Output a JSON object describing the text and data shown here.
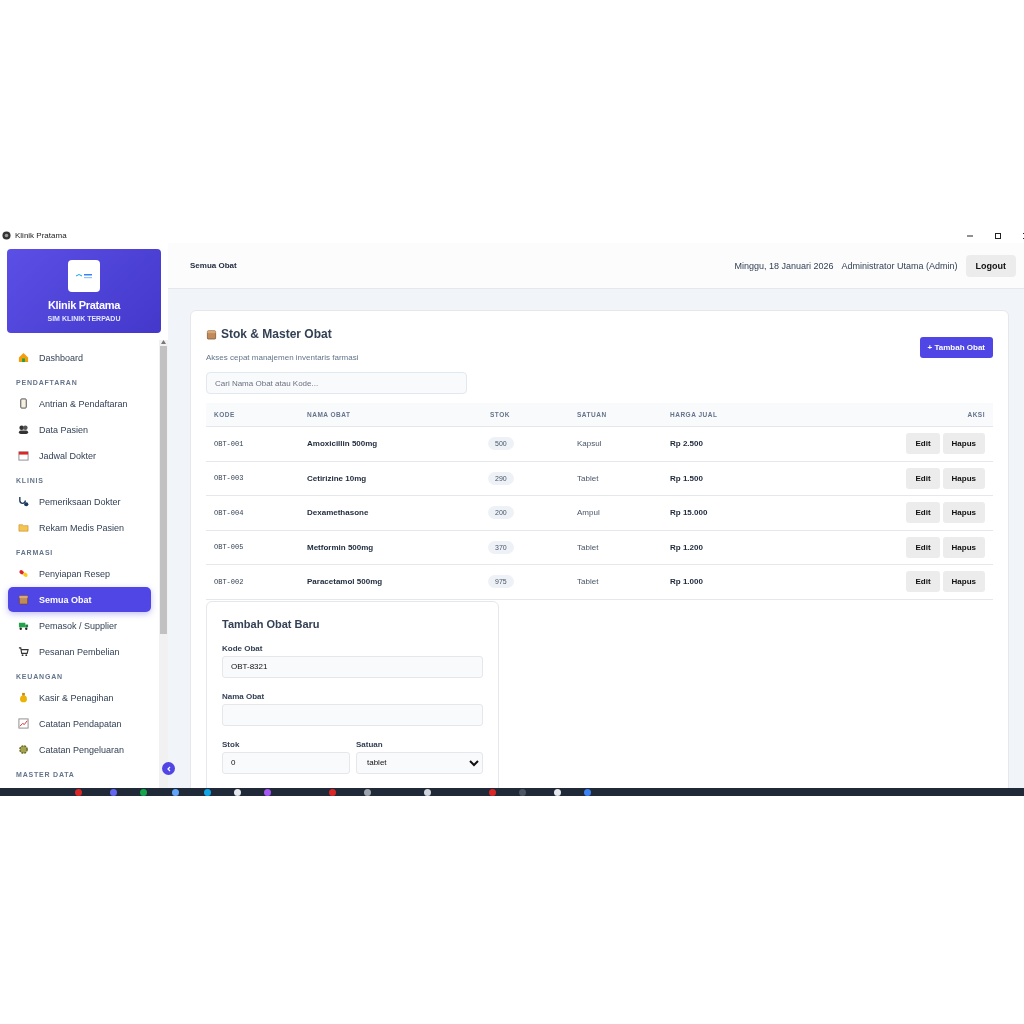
{
  "window": {
    "title": "Klinik Pratama"
  },
  "sidebar": {
    "brand": {
      "name": "Klinik Pratama",
      "tagline": "SIM KLINIK TERPADU"
    },
    "sections": [
      {
        "items": [
          {
            "label": "Dashboard",
            "selected": false
          }
        ]
      },
      {
        "heading": "PENDAFTARAN",
        "items": [
          {
            "label": "Antrian & Pendaftaran",
            "selected": false
          },
          {
            "label": "Data Pasien",
            "selected": false
          },
          {
            "label": "Jadwal Dokter",
            "selected": false
          }
        ]
      },
      {
        "heading": "KLINIS",
        "items": [
          {
            "label": "Pemeriksaan Dokter",
            "selected": false
          },
          {
            "label": "Rekam Medis Pasien",
            "selected": false
          }
        ]
      },
      {
        "heading": "FARMASI",
        "items": [
          {
            "label": "Penyiapan Resep",
            "selected": false
          },
          {
            "label": "Semua Obat",
            "selected": true
          },
          {
            "label": "Pemasok / Supplier",
            "selected": false
          },
          {
            "label": "Pesanan Pembelian",
            "selected": false
          }
        ]
      },
      {
        "heading": "KEUANGAN",
        "items": [
          {
            "label": "Kasir & Penagihan",
            "selected": false
          },
          {
            "label": "Catatan Pendapatan",
            "selected": false
          },
          {
            "label": "Catatan Pengeluaran",
            "selected": false
          }
        ]
      },
      {
        "heading": "MASTER DATA"
      }
    ]
  },
  "header": {
    "page_title": "Semua Obat",
    "date": "Minggu, 18 Januari 2026",
    "user": "Administrator Utama (Admin)",
    "logout": "Logout"
  },
  "card": {
    "title": "Stok & Master Obat",
    "subtitle": "Akses cepat manajemen inventaris farmasi",
    "add_button": "+ Tambah Obat",
    "search": {
      "placeholder": "Cari Nama Obat atau Kode..."
    },
    "table": {
      "columns": [
        "KODE",
        "NAMA OBAT",
        "STOK",
        "SATUAN",
        "HARGA JUAL",
        "AKSI"
      ],
      "rows": [
        {
          "code": "OBT-001",
          "name": "Amoxicillin 500mg",
          "stock": "500",
          "unit": "Kapsul",
          "price": "Rp 2.500",
          "actions": [
            "Edit",
            "Hapus"
          ]
        },
        {
          "code": "OBT-003",
          "name": "Cetirizine 10mg",
          "stock": "290",
          "unit": "Tablet",
          "price": "Rp 1.500",
          "actions": [
            "Edit",
            "Hapus"
          ]
        },
        {
          "code": "OBT-004",
          "name": "Dexamethasone",
          "stock": "200",
          "unit": "Ampul",
          "price": "Rp 15.000",
          "actions": [
            "Edit",
            "Hapus"
          ]
        },
        {
          "code": "OBT-005",
          "name": "Metformin 500mg",
          "stock": "370",
          "unit": "Tablet",
          "price": "Rp 1.200",
          "actions": [
            "Edit",
            "Hapus"
          ]
        },
        {
          "code": "OBT-002",
          "name": "Paracetamol 500mg",
          "stock": "975",
          "unit": "Tablet",
          "price": "Rp 1.000",
          "actions": [
            "Edit",
            "Hapus"
          ]
        }
      ]
    }
  },
  "form": {
    "title": "Tambah Obat Baru",
    "fields": [
      {
        "kind": "text",
        "label": "Kode Obat",
        "value": "OBT-8321"
      },
      {
        "kind": "text",
        "label": "Nama Obat"
      },
      {
        "kind": "pair",
        "items": [
          {
            "kind": "text",
            "label": "Stok",
            "value": "0"
          },
          {
            "kind": "select",
            "label": "Satuan",
            "value": "tablet"
          }
        ]
      }
    ]
  }
}
